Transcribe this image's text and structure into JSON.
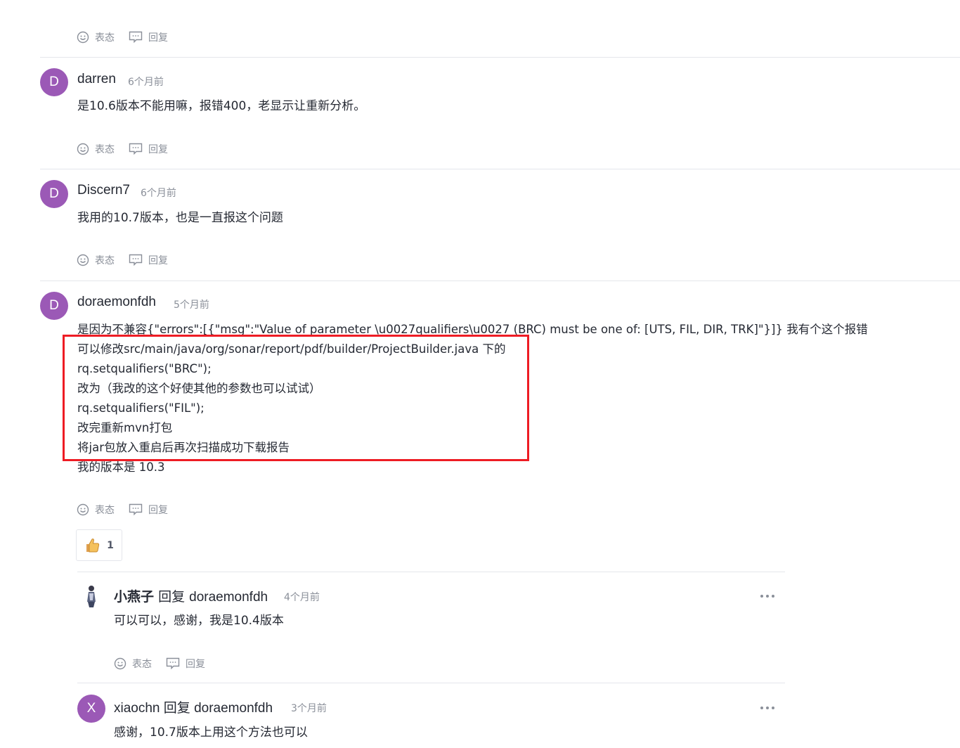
{
  "action_labels": {
    "react": "表态",
    "reply": "回复"
  },
  "comments": [
    {
      "avatar_letter": "D",
      "username": "darren",
      "time": "6个月前",
      "lines": [
        "是10.6版本不能用嘛，报错400，老显示让重新分析。"
      ]
    },
    {
      "avatar_letter": "D",
      "username": "Discern7",
      "time": "6个月前",
      "lines": [
        "我用的10.7版本，也是一直报这个问题"
      ]
    },
    {
      "avatar_letter": "D",
      "username": "doraemonfdh",
      "time": "5个月前",
      "lines": [
        "是因为不兼容{\"errors\":[{\"msg\":\"Value of parameter \\u0027qualifiers\\u0027 (BRC) must be one of: [UTS, FIL, DIR, TRK]\"}]} 我有个这个报错",
        "可以修改src/main/java/org/sonar/report/pdf/builder/ProjectBuilder.java 下的",
        "rq.setqualifiers(\"BRC\");",
        "改为（我改的这个好使其他的参数也可以试试）",
        "rq.setqualifiers(\"FIL\");",
        "改完重新mvn打包",
        "将jar包放入重启后再次扫描成功下载报告",
        "我的版本是 10.3"
      ],
      "like_count": "1"
    }
  ],
  "replies": [
    {
      "username": "小燕子",
      "reply_word": "回复",
      "reply_to": "doraemonfdh",
      "time": "4个月前",
      "text": "可以可以，感谢，我是10.4版本"
    },
    {
      "avatar_letter": "X",
      "username": "xiaochn",
      "reply_word": "回复",
      "reply_to": "doraemonfdh",
      "time": "3个月前",
      "text": "感谢，10.7版本上用这个方法也可以"
    }
  ],
  "colors": {
    "avatar": "#9b59b6",
    "highlight": "#ee1c24",
    "divider": "#e4e6eb",
    "muted": "#8a8f99"
  },
  "icons": [
    "smile-icon",
    "comment-icon",
    "thumbs-up-icon",
    "more-icon"
  ]
}
